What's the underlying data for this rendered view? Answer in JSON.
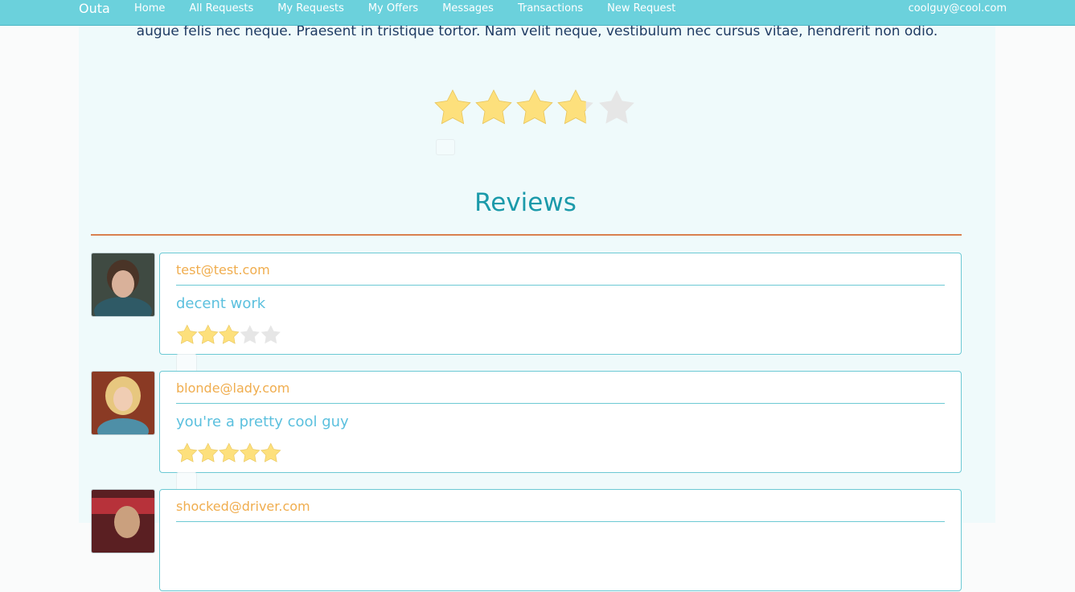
{
  "nav": {
    "brand": "Outa",
    "links": [
      "Home",
      "All Requests",
      "My Requests",
      "My Offers",
      "Messages",
      "Transactions",
      "New Request"
    ],
    "user_email": "coolguy@cool.com"
  },
  "request": {
    "description_tail": "augue felis nec neque. Praesent in tristique tortor. Nam velit neque, vestibulum nec cursus vitae, hendrerit non odio.",
    "rating": 3.7,
    "max_rating": 5
  },
  "reviews": {
    "heading": "Reviews",
    "items": [
      {
        "email": "test@test.com",
        "comment": "decent work",
        "rating": 3
      },
      {
        "email": "blonde@lady.com",
        "comment": "you're a pretty cool guy",
        "rating": 5
      },
      {
        "email": "shocked@driver.com",
        "comment": "",
        "rating": 0
      }
    ]
  },
  "colors": {
    "navbar": "#6bd1dc",
    "star_filled": "#fde07c",
    "star_empty": "#e6e6e6",
    "heading": "#1b9aaa",
    "rule": "#d9804f",
    "email": "#f0ad4e",
    "comment": "#5bc0de"
  }
}
